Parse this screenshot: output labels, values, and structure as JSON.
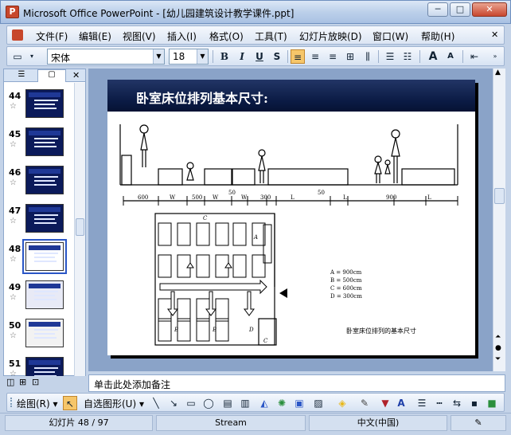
{
  "window": {
    "title": "Microsoft Office PowerPoint - [幼儿园建筑设计教学课件.ppt]",
    "app_icon_letter": "P",
    "minimize": "─",
    "maximize": "□",
    "close": "✕"
  },
  "menu": {
    "items": [
      "文件(F)",
      "编辑(E)",
      "视图(V)",
      "插入(I)",
      "格式(O)",
      "工具(T)",
      "幻灯片放映(D)",
      "窗口(W)",
      "帮助(H)"
    ],
    "close_doc": "✕"
  },
  "toolbar": {
    "font_name": "宋体",
    "font_size": "18",
    "bold": "B",
    "italic": "I",
    "underline": "U",
    "shadow": "S",
    "grow_font": "A",
    "shrink_font": "A"
  },
  "panel": {
    "close": "✕",
    "slides": [
      {
        "num": "44"
      },
      {
        "num": "45"
      },
      {
        "num": "46"
      },
      {
        "num": "47"
      },
      {
        "num": "48"
      },
      {
        "num": "49"
      },
      {
        "num": "50"
      },
      {
        "num": "51"
      }
    ],
    "star": "☆"
  },
  "slide": {
    "title": "卧室床位排列基本尺寸:",
    "dims_top": [
      "600",
      "W",
      "500",
      "W",
      "50",
      "W",
      "300",
      "L",
      "50",
      "L",
      "900",
      "L"
    ],
    "plan_labels": [
      "C",
      "A",
      "B",
      "B",
      "D",
      "C"
    ],
    "legend": [
      "A = 900cm",
      "B = 500cm",
      "C = 600cm",
      "D = 300cm"
    ],
    "caption": "卧室床位排列的基本尺寸"
  },
  "notes": {
    "placeholder": "单击此处添加备注"
  },
  "drawbar": {
    "draw_label": "绘图(R) ▾",
    "autoshapes_label": "自选图形(U) ▾"
  },
  "status": {
    "slide": "幻灯片 48 / 97",
    "design": "Stream",
    "language": "中文(中国)"
  }
}
